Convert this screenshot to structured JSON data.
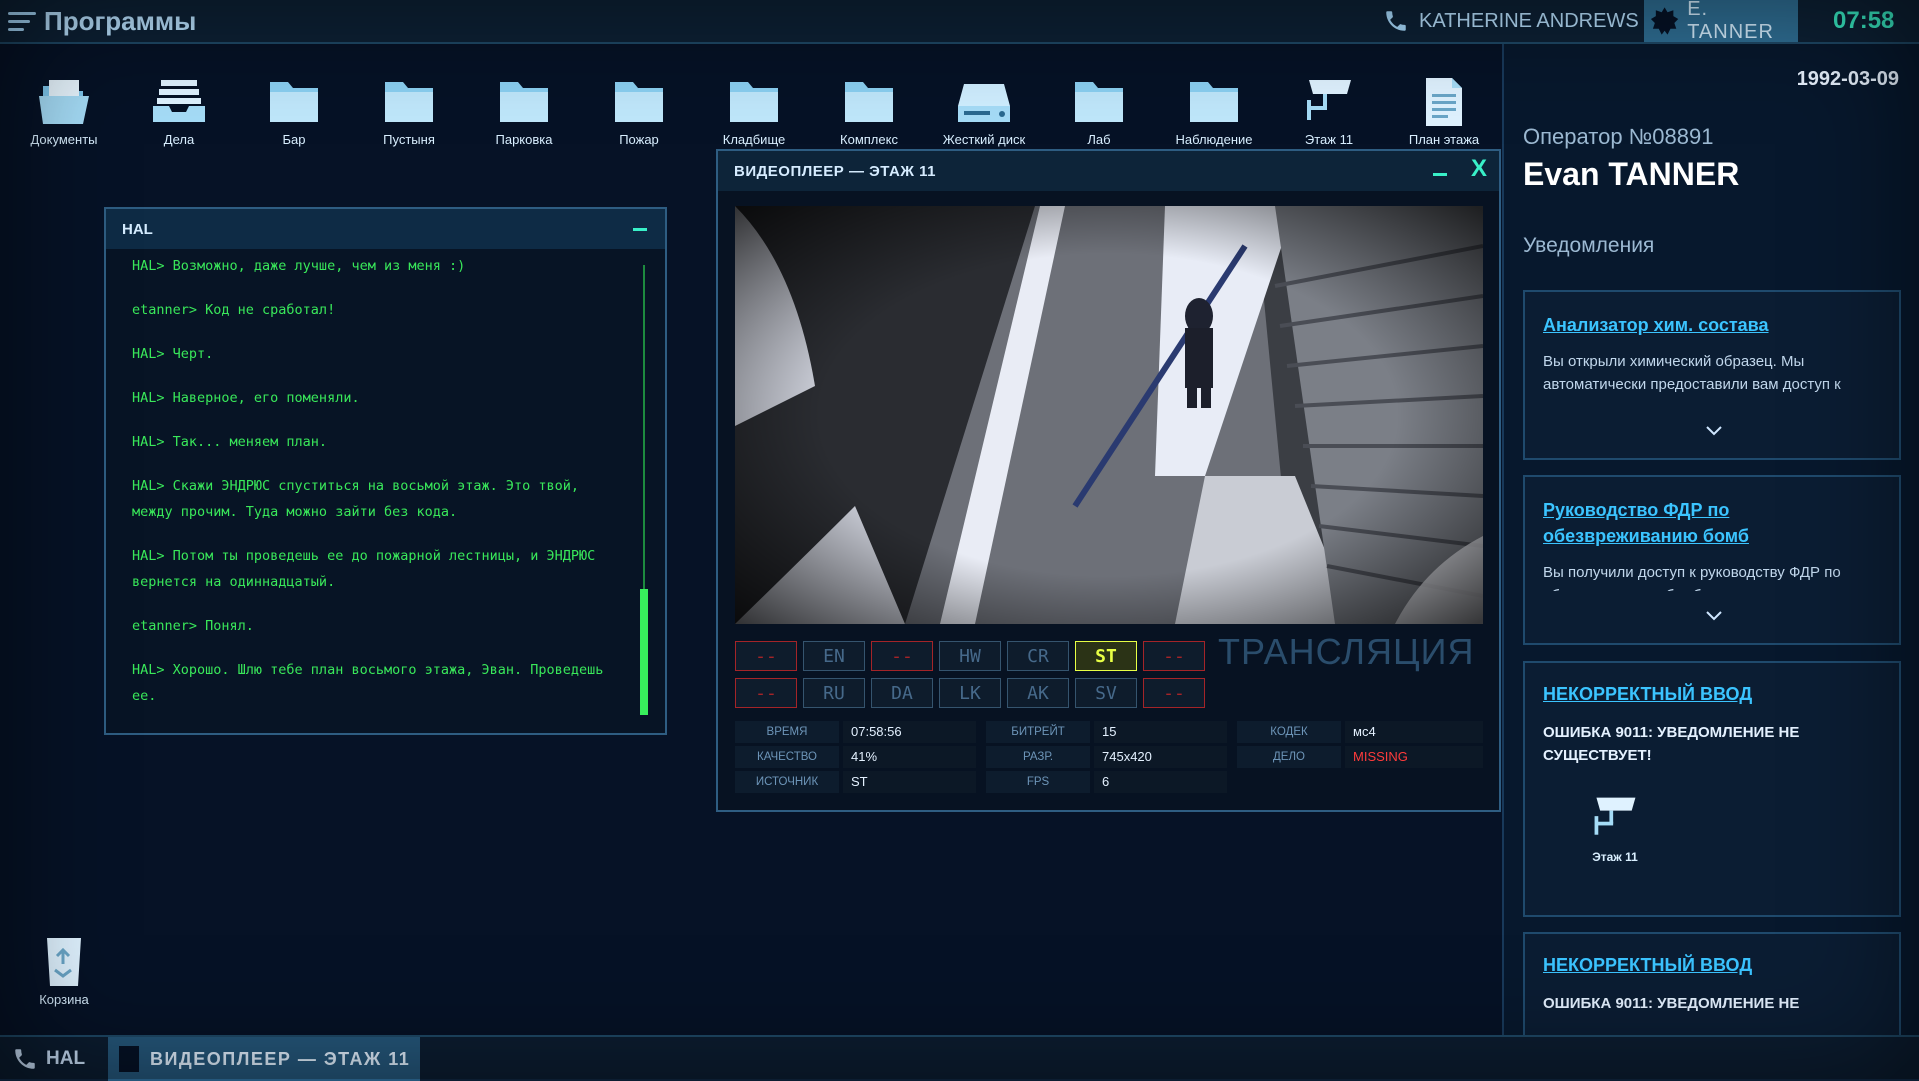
{
  "topbar": {
    "menu_label": "Программы",
    "contact_name": "KATHERINE ANDREWS",
    "user_name": "E. TANNER",
    "clock": "07:58"
  },
  "desktop_icons": [
    {
      "label": "Документы",
      "icon": "folder-open-icon"
    },
    {
      "label": "Дела",
      "icon": "inbox-tray-icon"
    },
    {
      "label": "Бар",
      "icon": "folder-icon"
    },
    {
      "label": "Пустыня",
      "icon": "folder-icon"
    },
    {
      "label": "Парковка",
      "icon": "folder-icon"
    },
    {
      "label": "Пожар",
      "icon": "folder-icon"
    },
    {
      "label": "Кладбище",
      "icon": "folder-icon"
    },
    {
      "label": "Комплекс",
      "icon": "folder-icon"
    },
    {
      "label": "Жесткий диск",
      "icon": "hard-drive-icon"
    },
    {
      "label": "Лаб",
      "icon": "folder-icon"
    },
    {
      "label": "Наблюдение",
      "icon": "folder-icon"
    },
    {
      "label": "Этаж 11",
      "icon": "security-camera-icon"
    },
    {
      "label": "План этажа",
      "icon": "document-icon"
    }
  ],
  "recycle_bin": {
    "label": "Корзина"
  },
  "hal": {
    "title": "HAL",
    "lines": [
      "HAL> Возможно, даже лучше, чем из меня :)",
      "etanner> Код не сработал!",
      "HAL> Черт.",
      "HAL> Наверное, его поменяли.",
      "HAL> Так... меняем план.",
      "HAL> Скажи ЭНДРЮС спуститься на восьмой этаж. Это твой, между прочим. Туда можно зайти без кода.",
      "HAL> Потом ты проведешь ее до пожарной лестницы, и ЭНДРЮС вернется на одиннадцатый.",
      "etanner> Понял.",
      "HAL> Хорошо. Шлю тебе план восьмого этажа, Эван. Проведешь ее."
    ]
  },
  "video_player": {
    "title": "ВИДЕОПЛЕЕР — ЭТАЖ 11",
    "close_glyph": "X",
    "channels_row1": [
      "--",
      "EN",
      "--",
      "HW",
      "CR",
      "ST",
      "--"
    ],
    "channels_row2": [
      "--",
      "RU",
      "DA",
      "LK",
      "AK",
      "SV",
      "--"
    ],
    "active_channel": "ST",
    "broadcast_label": "ТРАНСЛЯЦИЯ",
    "stats": {
      "time_label": "ВРЕМЯ",
      "time": "07:58:56",
      "bitrate_label": "БИТРЕЙТ",
      "bitrate": "15",
      "codec_label": "КОДЕК",
      "codec": "мс4",
      "quality_label": "КАЧЕСТВО",
      "quality": "41%",
      "resolution_label": "РАЗР.",
      "resolution": "745x420",
      "case_label": "ДЕЛО",
      "case": "MISSING",
      "source_label": "ИСТОЧНИК",
      "source": "ST",
      "fps_label": "FPS",
      "fps": "6"
    }
  },
  "right_panel": {
    "date": "1992-03-09",
    "operator_label": "Оператор №08891",
    "operator_name": "Evan TANNER",
    "notifications_label": "Уведомления",
    "notifications": [
      {
        "title": "Анализатор хим. состава",
        "body": "Вы открыли химический образец. Мы автоматически предоставили вам доступ к программе CSLCA Data Report («Отчет о"
      },
      {
        "title_line1": "Руководство ФДР по",
        "title_line2": "обезвреживанию бомб",
        "body": "Вы получили доступ к руководству ФДР по обезвреживанию бомб."
      },
      {
        "title": "НЕКОРРЕКТНЫЙ ВВОД",
        "body_line1": "ОШИБКА 9011: УВЕДОМЛЕНИЕ НЕ",
        "body_line2": "СУЩЕСТВУЕТ!",
        "attachment_label": "Этаж 11"
      },
      {
        "title": "НЕКОРРЕКТНЫЙ ВВОД",
        "body_line1": "ОШИБКА 9011: УВЕДОМЛЕНИЕ НЕ"
      }
    ]
  },
  "taskbar": {
    "hal_label": "HAL",
    "video_label": "ВИДЕОПЛЕЕР — ЭТАЖ 11"
  },
  "colors": {
    "accent_cyan": "#39f0c8",
    "terminal_green": "#39e85a",
    "active_channel": "#e8ff45",
    "error_red": "#ff3b3b",
    "link_blue": "#3bc4ff"
  }
}
